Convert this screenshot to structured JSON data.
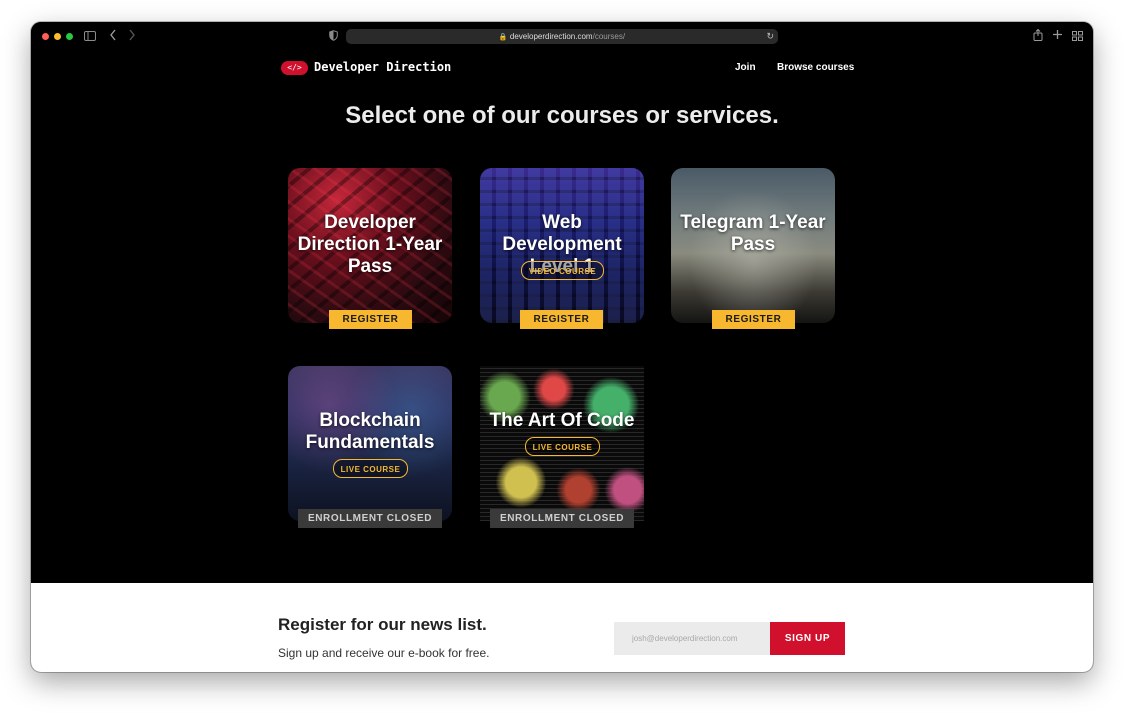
{
  "browser": {
    "url_domain": "developerdirection.com",
    "url_path": "/courses/"
  },
  "site": {
    "logo_badge": "</>",
    "name": "Developer Direction",
    "nav": {
      "join": "Join",
      "browse": "Browse courses"
    }
  },
  "hero": {
    "title": "Select one of our courses or services."
  },
  "cards": [
    {
      "title": "Developer Direction 1-Year Pass",
      "badge": "",
      "action": "REGISTER",
      "action_type": "register"
    },
    {
      "title": "Web Development Level 1",
      "badge": "VIDEO COURSE",
      "action": "REGISTER",
      "action_type": "register"
    },
    {
      "title": "Telegram 1-Year Pass",
      "badge": "",
      "action": "REGISTER",
      "action_type": "register"
    },
    {
      "title": "Blockchain Fundamentals",
      "badge": "LIVE COURSE",
      "action": "ENROLLMENT CLOSED",
      "action_type": "closed"
    },
    {
      "title": "The Art Of Code",
      "badge": "LIVE COURSE",
      "action": "ENROLLMENT CLOSED",
      "action_type": "closed"
    }
  ],
  "newsletter": {
    "title": "Register for our news list.",
    "subtitle": "Sign up and receive our e-book for free.",
    "email_placeholder": "josh@developerdirection.com",
    "button": "SIGN UP"
  },
  "colors": {
    "accent_red": "#d0102d",
    "accent_yellow": "#f7b82f",
    "closed_gray": "#3a3a3a"
  }
}
